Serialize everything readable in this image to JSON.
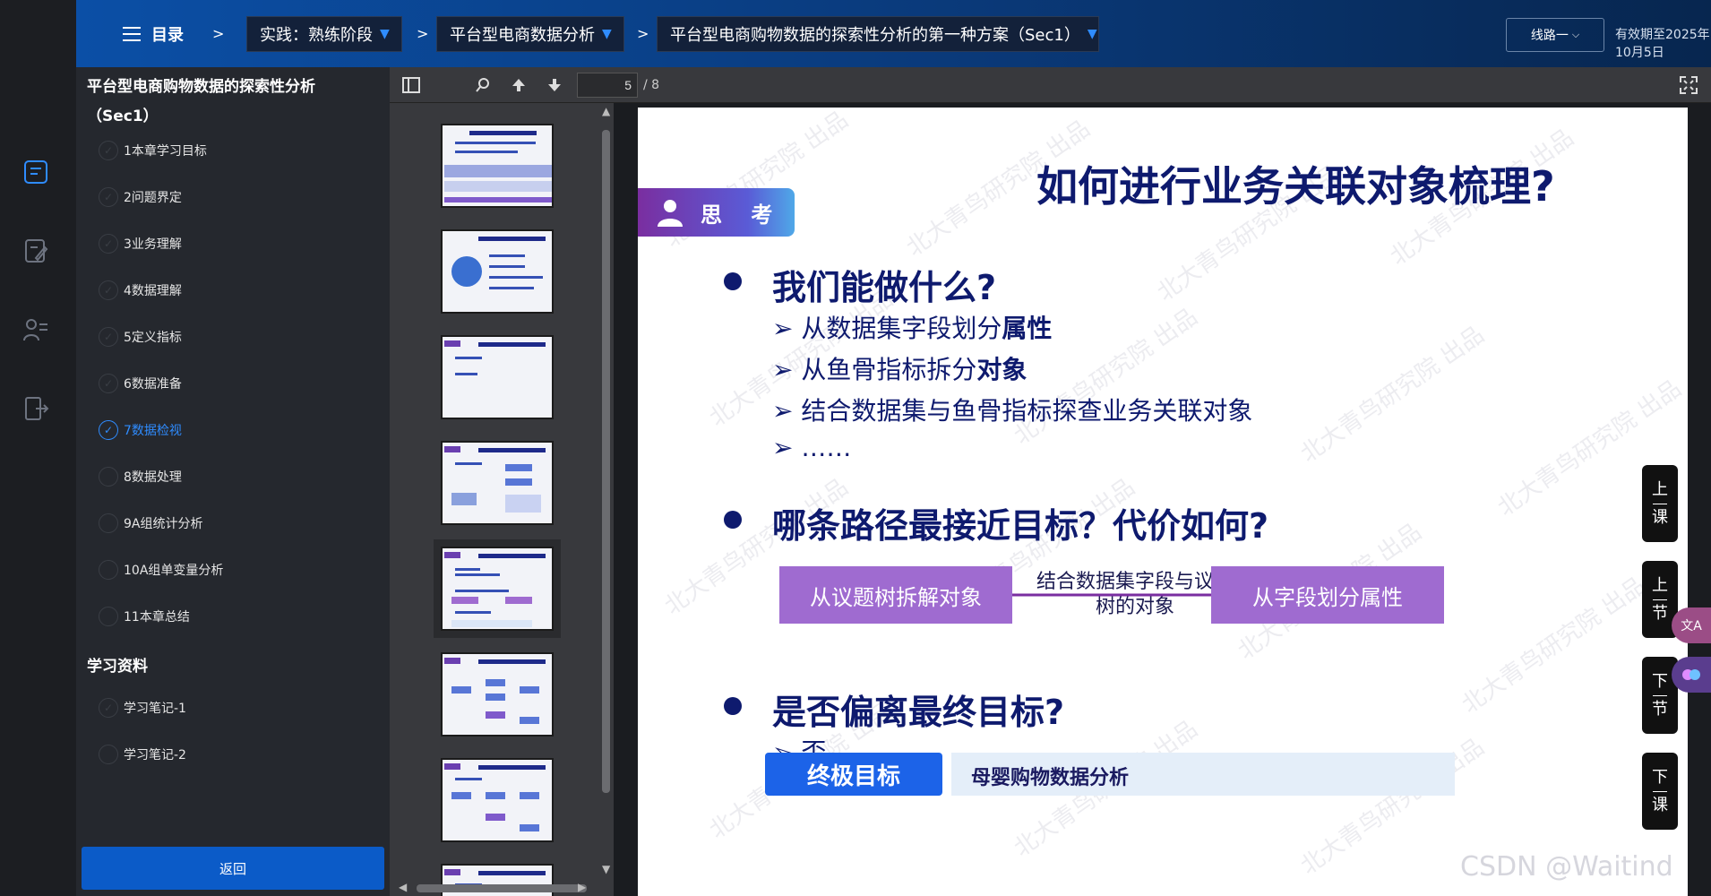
{
  "topbar": {
    "menu_label": "目录",
    "crumbs": [
      {
        "label": "实践：熟练阶段"
      },
      {
        "label": "平台型电商数据分析"
      },
      {
        "label": "平台型电商购物数据的探索性分析的第一种方案（Sec1）"
      }
    ],
    "separator": ">",
    "line_button": "线路一",
    "valid_until": "有效期至2025年10月5日"
  },
  "sidebar": {
    "title": "平台型电商购物数据的探索性分析（Sec1）",
    "items": [
      {
        "label": "1本章学习目标"
      },
      {
        "label": "2问题界定"
      },
      {
        "label": "3业务理解"
      },
      {
        "label": "4数据理解"
      },
      {
        "label": "5定义指标"
      },
      {
        "label": "6数据准备"
      },
      {
        "label": "7数据检视"
      },
      {
        "label": "8数据处理"
      },
      {
        "label": "9A组统计分析"
      },
      {
        "label": "10A组单变量分析"
      },
      {
        "label": "11本章总结"
      }
    ],
    "active_index": 6,
    "section_title": "学习资料",
    "materials": [
      {
        "label": "学习笔记-1"
      },
      {
        "label": "学习笔记-2"
      }
    ],
    "back_label": "返回"
  },
  "pdf": {
    "current_page": "5",
    "total_pages": "/ 8"
  },
  "slide": {
    "tag": "思 考",
    "title": "如何进行业务关联对象梳理?",
    "q1": "我们能做什么?",
    "q1_subs": [
      {
        "pre": "从数据集字段划分",
        "bold": "属性"
      },
      {
        "pre": "从鱼骨指标拆分",
        "bold": "对象"
      },
      {
        "pre": "结合数据集与鱼骨指标探查业务关联对象",
        "bold": ""
      },
      {
        "pre": "……",
        "bold": ""
      }
    ],
    "q2": "哪条路径最接近目标？代价如何?",
    "box_left": "从议题树拆解对象",
    "box_mid": "结合数据集字段与议题树的对象",
    "box_right": "从字段划分属性",
    "q3": "是否偏离最终目标?",
    "partial_text": "否",
    "goal_label": "终极目标",
    "goal_text": "母婴购物数据分析",
    "watermark": "北大青鸟研究院 出品"
  },
  "nav": {
    "prev_class": [
      "上",
      "课"
    ],
    "prev_section": [
      "上",
      "节"
    ],
    "next_section": [
      "下",
      "节"
    ],
    "next_class": [
      "下",
      "课"
    ]
  },
  "footer_watermark": "CSDN @Waitind"
}
